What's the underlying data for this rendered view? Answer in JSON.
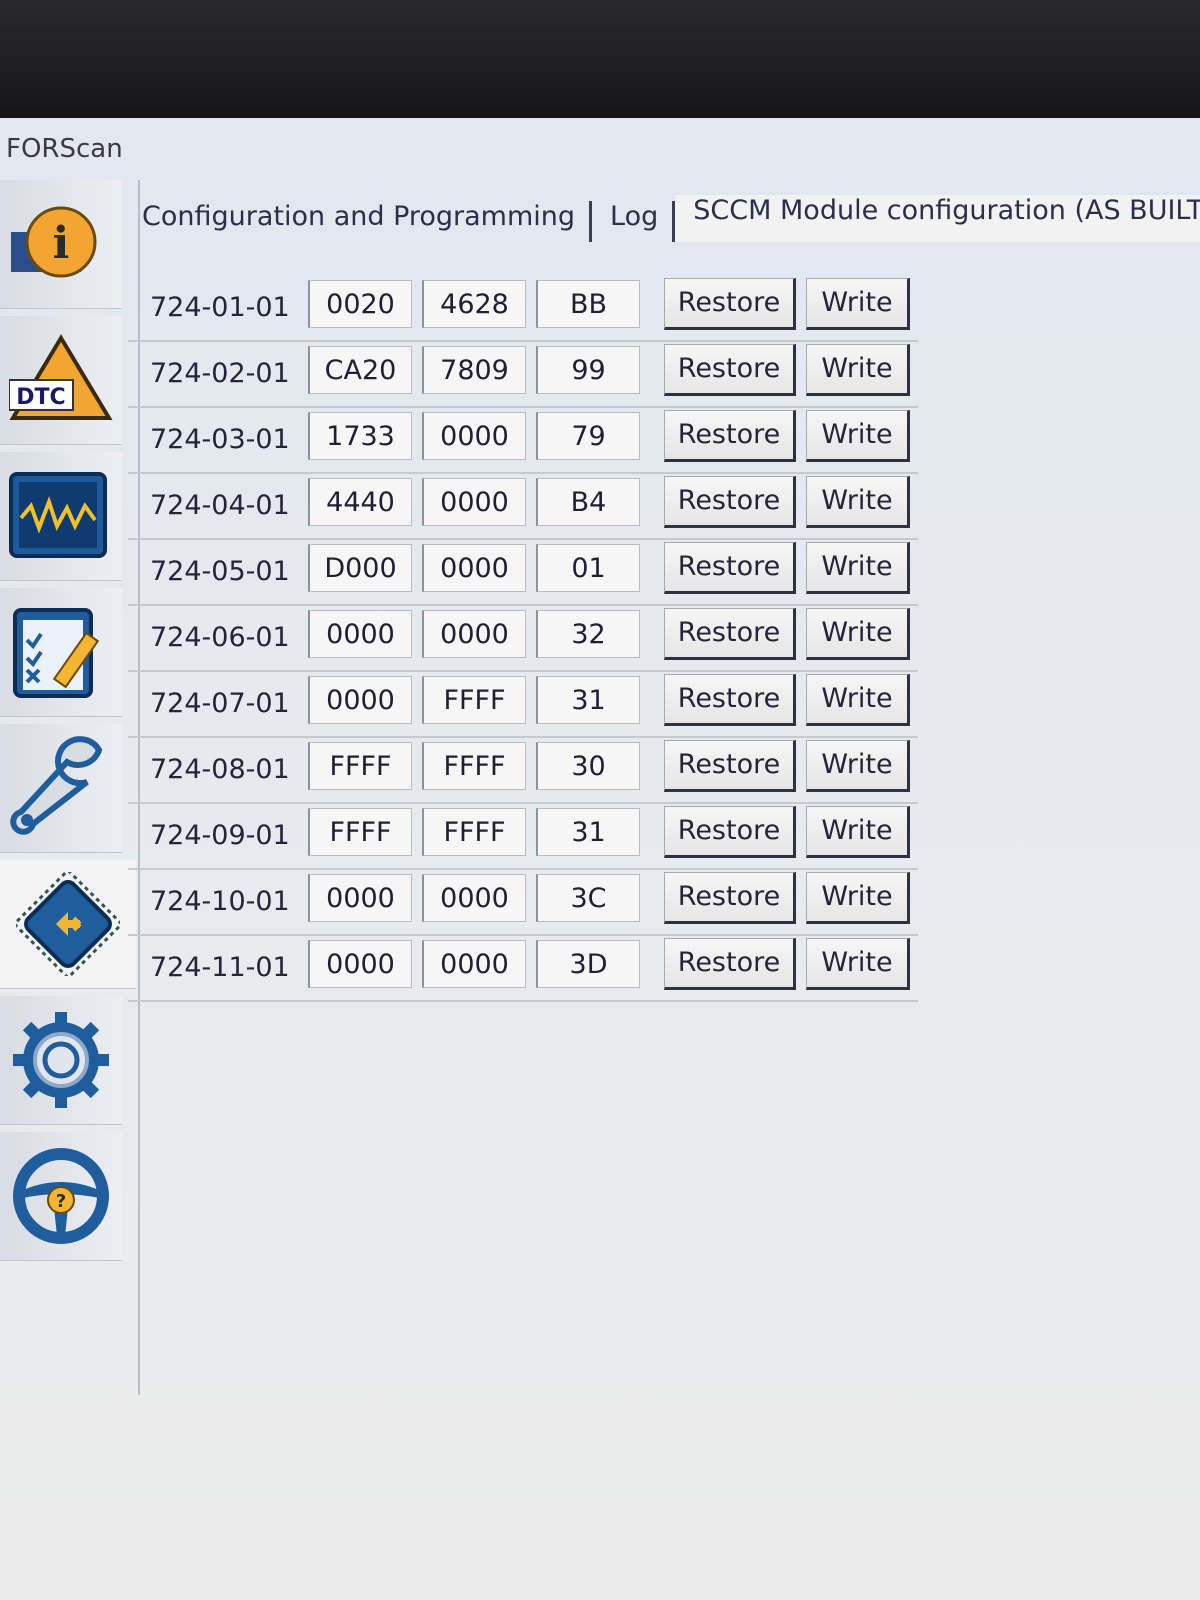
{
  "app": {
    "title": "FORScan"
  },
  "tabs": [
    {
      "label": "Configuration and Programming"
    },
    {
      "label": "Log"
    },
    {
      "label": "SCCM Module configuration (AS BUILT fo"
    }
  ],
  "sidebar": {
    "items": [
      {
        "icon": "info-icon"
      },
      {
        "icon": "dtc-icon",
        "label": "DTC"
      },
      {
        "icon": "oscilloscope-icon"
      },
      {
        "icon": "checklist-icon"
      },
      {
        "icon": "wrench-icon"
      },
      {
        "icon": "module-chip-icon"
      },
      {
        "icon": "settings-gear-icon"
      },
      {
        "icon": "help-steering-wheel-icon"
      }
    ]
  },
  "config": {
    "restore_label": "Restore",
    "write_label": "Write",
    "rows": [
      {
        "addr": "724-01-01",
        "v1": "0020",
        "v2": "4628",
        "v3": "BB"
      },
      {
        "addr": "724-02-01",
        "v1": "CA20",
        "v2": "7809",
        "v3": "99"
      },
      {
        "addr": "724-03-01",
        "v1": "1733",
        "v2": "0000",
        "v3": "79"
      },
      {
        "addr": "724-04-01",
        "v1": "4440",
        "v2": "0000",
        "v3": "B4"
      },
      {
        "addr": "724-05-01",
        "v1": "D000",
        "v2": "0000",
        "v3": "01"
      },
      {
        "addr": "724-06-01",
        "v1": "0000",
        "v2": "0000",
        "v3": "32"
      },
      {
        "addr": "724-07-01",
        "v1": "0000",
        "v2": "FFFF",
        "v3": "31"
      },
      {
        "addr": "724-08-01",
        "v1": "FFFF",
        "v2": "FFFF",
        "v3": "30"
      },
      {
        "addr": "724-09-01",
        "v1": "FFFF",
        "v2": "FFFF",
        "v3": "31"
      },
      {
        "addr": "724-10-01",
        "v1": "0000",
        "v2": "0000",
        "v3": "3C"
      },
      {
        "addr": "724-11-01",
        "v1": "0000",
        "v2": "0000",
        "v3": "3D"
      }
    ]
  }
}
